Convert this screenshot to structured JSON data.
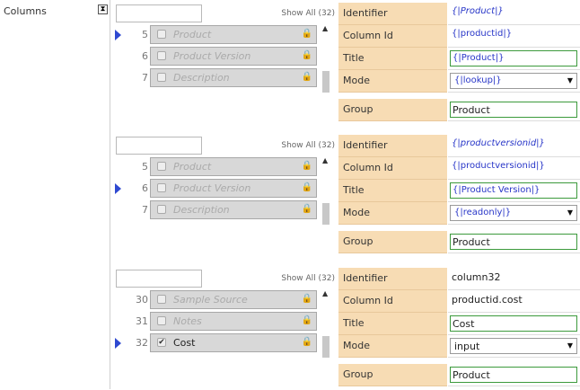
{
  "left_label": "Columns",
  "collapse_glyph": "⧗",
  "sections": [
    {
      "search_value": "",
      "show_all": "Show All (32)",
      "rows": [
        {
          "num": "5",
          "label": "Product",
          "checked": false,
          "selected": true,
          "active": false
        },
        {
          "num": "6",
          "label": "Product Version",
          "checked": false,
          "selected": false,
          "active": false
        },
        {
          "num": "7",
          "label": "Description",
          "checked": false,
          "selected": false,
          "active": false
        }
      ],
      "props": {
        "identifier": "{|Product|}",
        "column_id": "{|productid|}",
        "title": "{|Product|}",
        "mode": "{|lookup|}",
        "group": "Product"
      }
    },
    {
      "search_value": "",
      "show_all": "Show All (32)",
      "rows": [
        {
          "num": "5",
          "label": "Product",
          "checked": false,
          "selected": false,
          "active": false
        },
        {
          "num": "6",
          "label": "Product Version",
          "checked": false,
          "selected": true,
          "active": false
        },
        {
          "num": "7",
          "label": "Description",
          "checked": false,
          "selected": false,
          "active": false
        }
      ],
      "props": {
        "identifier": "{|productversionid|}",
        "column_id": "{|productversionid|}",
        "title": "{|Product Version|}",
        "mode": "{|readonly|}",
        "group": "Product"
      }
    },
    {
      "search_value": "",
      "show_all": "Show All (32)",
      "rows": [
        {
          "num": "30",
          "label": "Sample Source",
          "checked": false,
          "selected": false,
          "active": false
        },
        {
          "num": "31",
          "label": "Notes",
          "checked": false,
          "selected": false,
          "active": false
        },
        {
          "num": "32",
          "label": "Cost",
          "checked": true,
          "selected": true,
          "active": true
        }
      ],
      "props": {
        "identifier": "column32",
        "column_id": "productid.cost",
        "title": "Cost",
        "mode": "input",
        "group": "Product"
      }
    }
  ],
  "labels": {
    "identifier": "Identifier",
    "column_id": "Column Id",
    "title": "Title",
    "mode": "Mode",
    "group": "Group"
  },
  "icons": {
    "lock": "lock-icon",
    "arrow": "selected-arrow-icon",
    "caret": "chevron-down-icon",
    "scroll_up": "scroll-up-icon"
  },
  "colors": {
    "key_bg": "#f7dcb4",
    "expr_text": "#2836c8",
    "title_border": "#3c9a3c",
    "selection_arrow": "#2f49d1"
  }
}
